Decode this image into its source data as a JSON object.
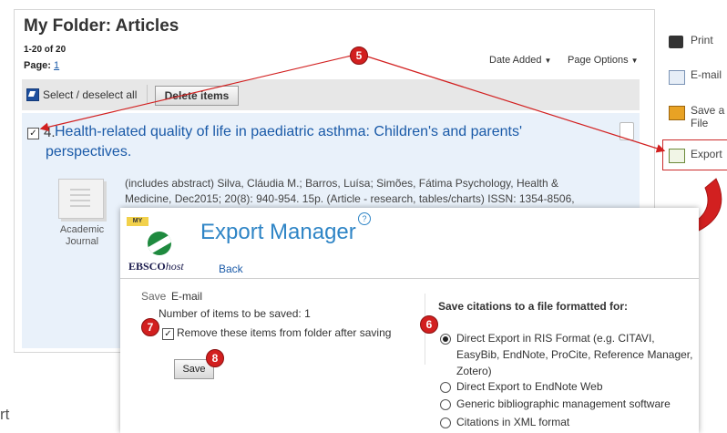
{
  "folder": {
    "title": "My Folder: Articles",
    "count": "1-20 of 20",
    "page_label": "Page:",
    "page_num": "1",
    "date_added": "Date Added",
    "page_options": "Page Options"
  },
  "toolbar": {
    "select_all": "Select / deselect all",
    "delete": "Delete items"
  },
  "item": {
    "number": "4.",
    "title": "Health-related quality of life in paediatric asthma: Children's and parents' perspectives.",
    "type": "Academic Journal",
    "abstract": "(includes abstract) Silva, Cláudia M.; Barros, Luísa; Simões, Fátima Psychology, Health & Medicine, Dec2015; 20(8): 940-954. 15p. (Article - research, tables/charts) ISSN: 1354-8506,"
  },
  "sidebar": {
    "print": "Print",
    "email": "E-mail",
    "save": "Save a File",
    "export": "Export"
  },
  "export_manager": {
    "tag": "MY",
    "brand": "EBSCO",
    "brand_host": "host",
    "title": "Export Manager",
    "help": "?",
    "back": "Back",
    "save_tab": "Save",
    "email_tab": "E-mail",
    "num_items": "Number of items to be saved: 1",
    "remove_label": "Remove these items from folder after saving",
    "save_button": "Save",
    "format_heading": "Save citations to a file formatted for:",
    "options": [
      {
        "label": "Direct Export in RIS Format (e.g. CITAVI, EasyBib, EndNote, ProCite, Reference Manager, Zotero)",
        "selected": true
      },
      {
        "label": "Direct Export to EndNote Web",
        "selected": false
      },
      {
        "label": "Generic bibliographic management software",
        "selected": false
      },
      {
        "label": "Citations in XML format",
        "selected": false
      }
    ]
  },
  "callouts": {
    "five": "5",
    "six": "6",
    "seven": "7",
    "eight": "8"
  },
  "fragment": "rt",
  "colors": {
    "link": "#1a5aa8",
    "accent": "#2f85c6",
    "callout": "#d21f1f"
  }
}
